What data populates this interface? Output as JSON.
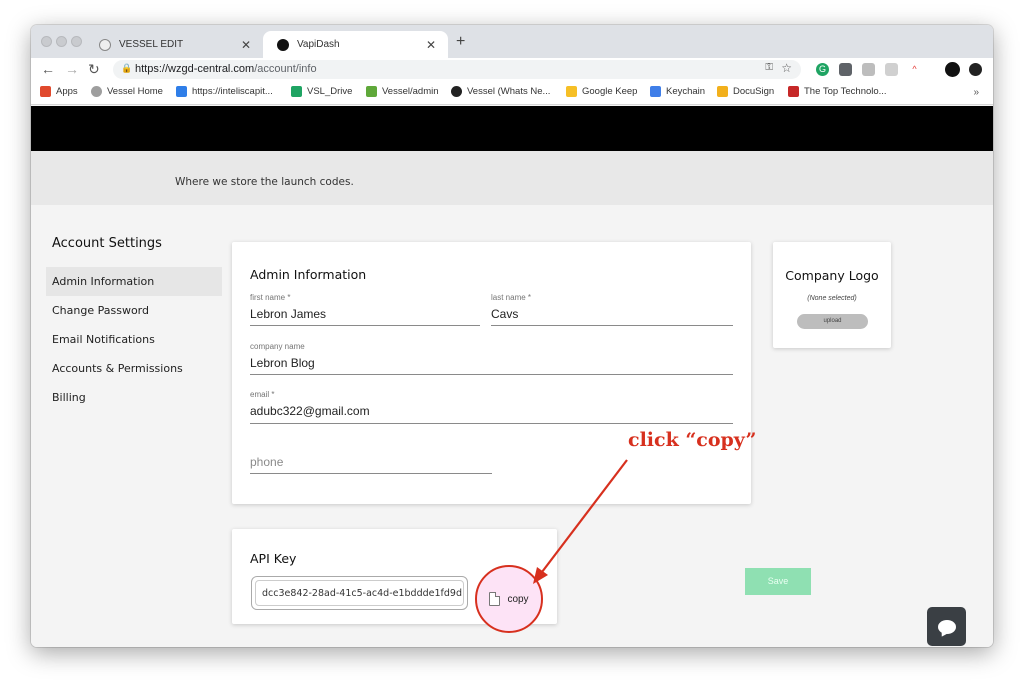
{
  "browser": {
    "tabs": [
      {
        "title": "VESSEL EDIT",
        "active": false
      },
      {
        "title": "VapiDash",
        "active": true
      }
    ],
    "url_host": "https://wzgd-central.com",
    "url_path": "/account/info",
    "bookmarks": [
      {
        "label": "Apps",
        "color": "#e0492d"
      },
      {
        "label": "Vessel Home",
        "color": "#9e9e9e"
      },
      {
        "label": "https://inteliscapit...",
        "color": "#2f7ee8"
      },
      {
        "label": "VSL_Drive",
        "color": "#1fa463"
      },
      {
        "label": "Vessel/admin",
        "color": "#5fa83a"
      },
      {
        "label": "Vessel (Whats Ne...",
        "color": "#222222"
      },
      {
        "label": "Google Keep",
        "color": "#f6bf26"
      },
      {
        "label": "Keychain",
        "color": "#3f7ee8"
      },
      {
        "label": "DocuSign",
        "color": "#f2b01c"
      },
      {
        "label": "The Top Technolo...",
        "color": "#c62828"
      }
    ],
    "bookmarks_more": "»"
  },
  "page": {
    "tagline": "Where we store the launch codes.",
    "sidebar": {
      "title": "Account Settings",
      "items": [
        {
          "label": "Admin Information",
          "selected": true
        },
        {
          "label": "Change Password",
          "selected": false
        },
        {
          "label": "Email Notifications",
          "selected": false
        },
        {
          "label": "Accounts & Permissions",
          "selected": false
        },
        {
          "label": "Billing",
          "selected": false
        }
      ]
    },
    "admin_card": {
      "title": "Admin Information",
      "first_name_label": "first name *",
      "first_name_value": "Lebron James",
      "last_name_label": "last name *",
      "last_name_value": "Cavs",
      "company_label": "company name",
      "company_value": "Lebron Blog",
      "email_label": "email *",
      "email_value": "adubc322@gmail.com",
      "phone_placeholder": "phone"
    },
    "logo_card": {
      "title": "Company Logo",
      "status": "(None selected)",
      "upload_label": "upload"
    },
    "api_card": {
      "title": "API Key",
      "key_value": "dcc3e842-28ad-41c5-ac4d-e1bddde1fd9d",
      "copy_label": "copy"
    },
    "save_label": "Save",
    "annotation": "click “copy”",
    "annotation_color": "#d7301e"
  }
}
